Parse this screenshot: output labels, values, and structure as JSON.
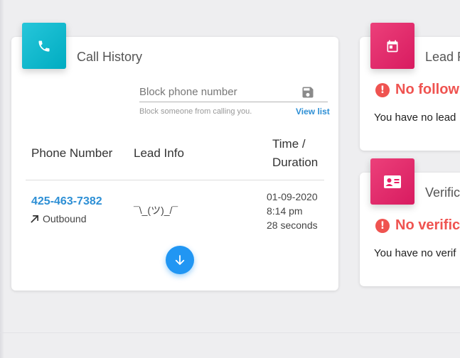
{
  "call_history": {
    "title": "Call History",
    "block_input": {
      "placeholder": "Block phone number",
      "value": ""
    },
    "block_hint": "Block someone from calling you.",
    "view_list_label": "View list",
    "columns": {
      "phone_number": "Phone Number",
      "lead_info": "Lead Info",
      "time_duration_line1": "Time /",
      "time_duration_line2": "Duration"
    },
    "rows": [
      {
        "phone": "425-463-7382",
        "direction": "Outbound",
        "lead_info": "¯\\_(ツ)_/¯",
        "date": "01-09-2020",
        "time": "8:14 pm",
        "duration": "28 seconds"
      }
    ],
    "icon": "phone-icon",
    "accent_color": "#00acc1"
  },
  "followups": {
    "title": "Lead F",
    "warning": "No followu",
    "empty_message": "You have no lead",
    "icon": "calendar-icon",
    "accent_color": "#e91e63"
  },
  "verifications": {
    "title": "Verific",
    "warning": "No verifica",
    "empty_message": "You have no verif",
    "icon": "contact-card-icon",
    "accent_color": "#e91e63"
  },
  "colors": {
    "link": "#2d8fd5",
    "warning": "#ef5350",
    "fab": "#2196f3"
  }
}
